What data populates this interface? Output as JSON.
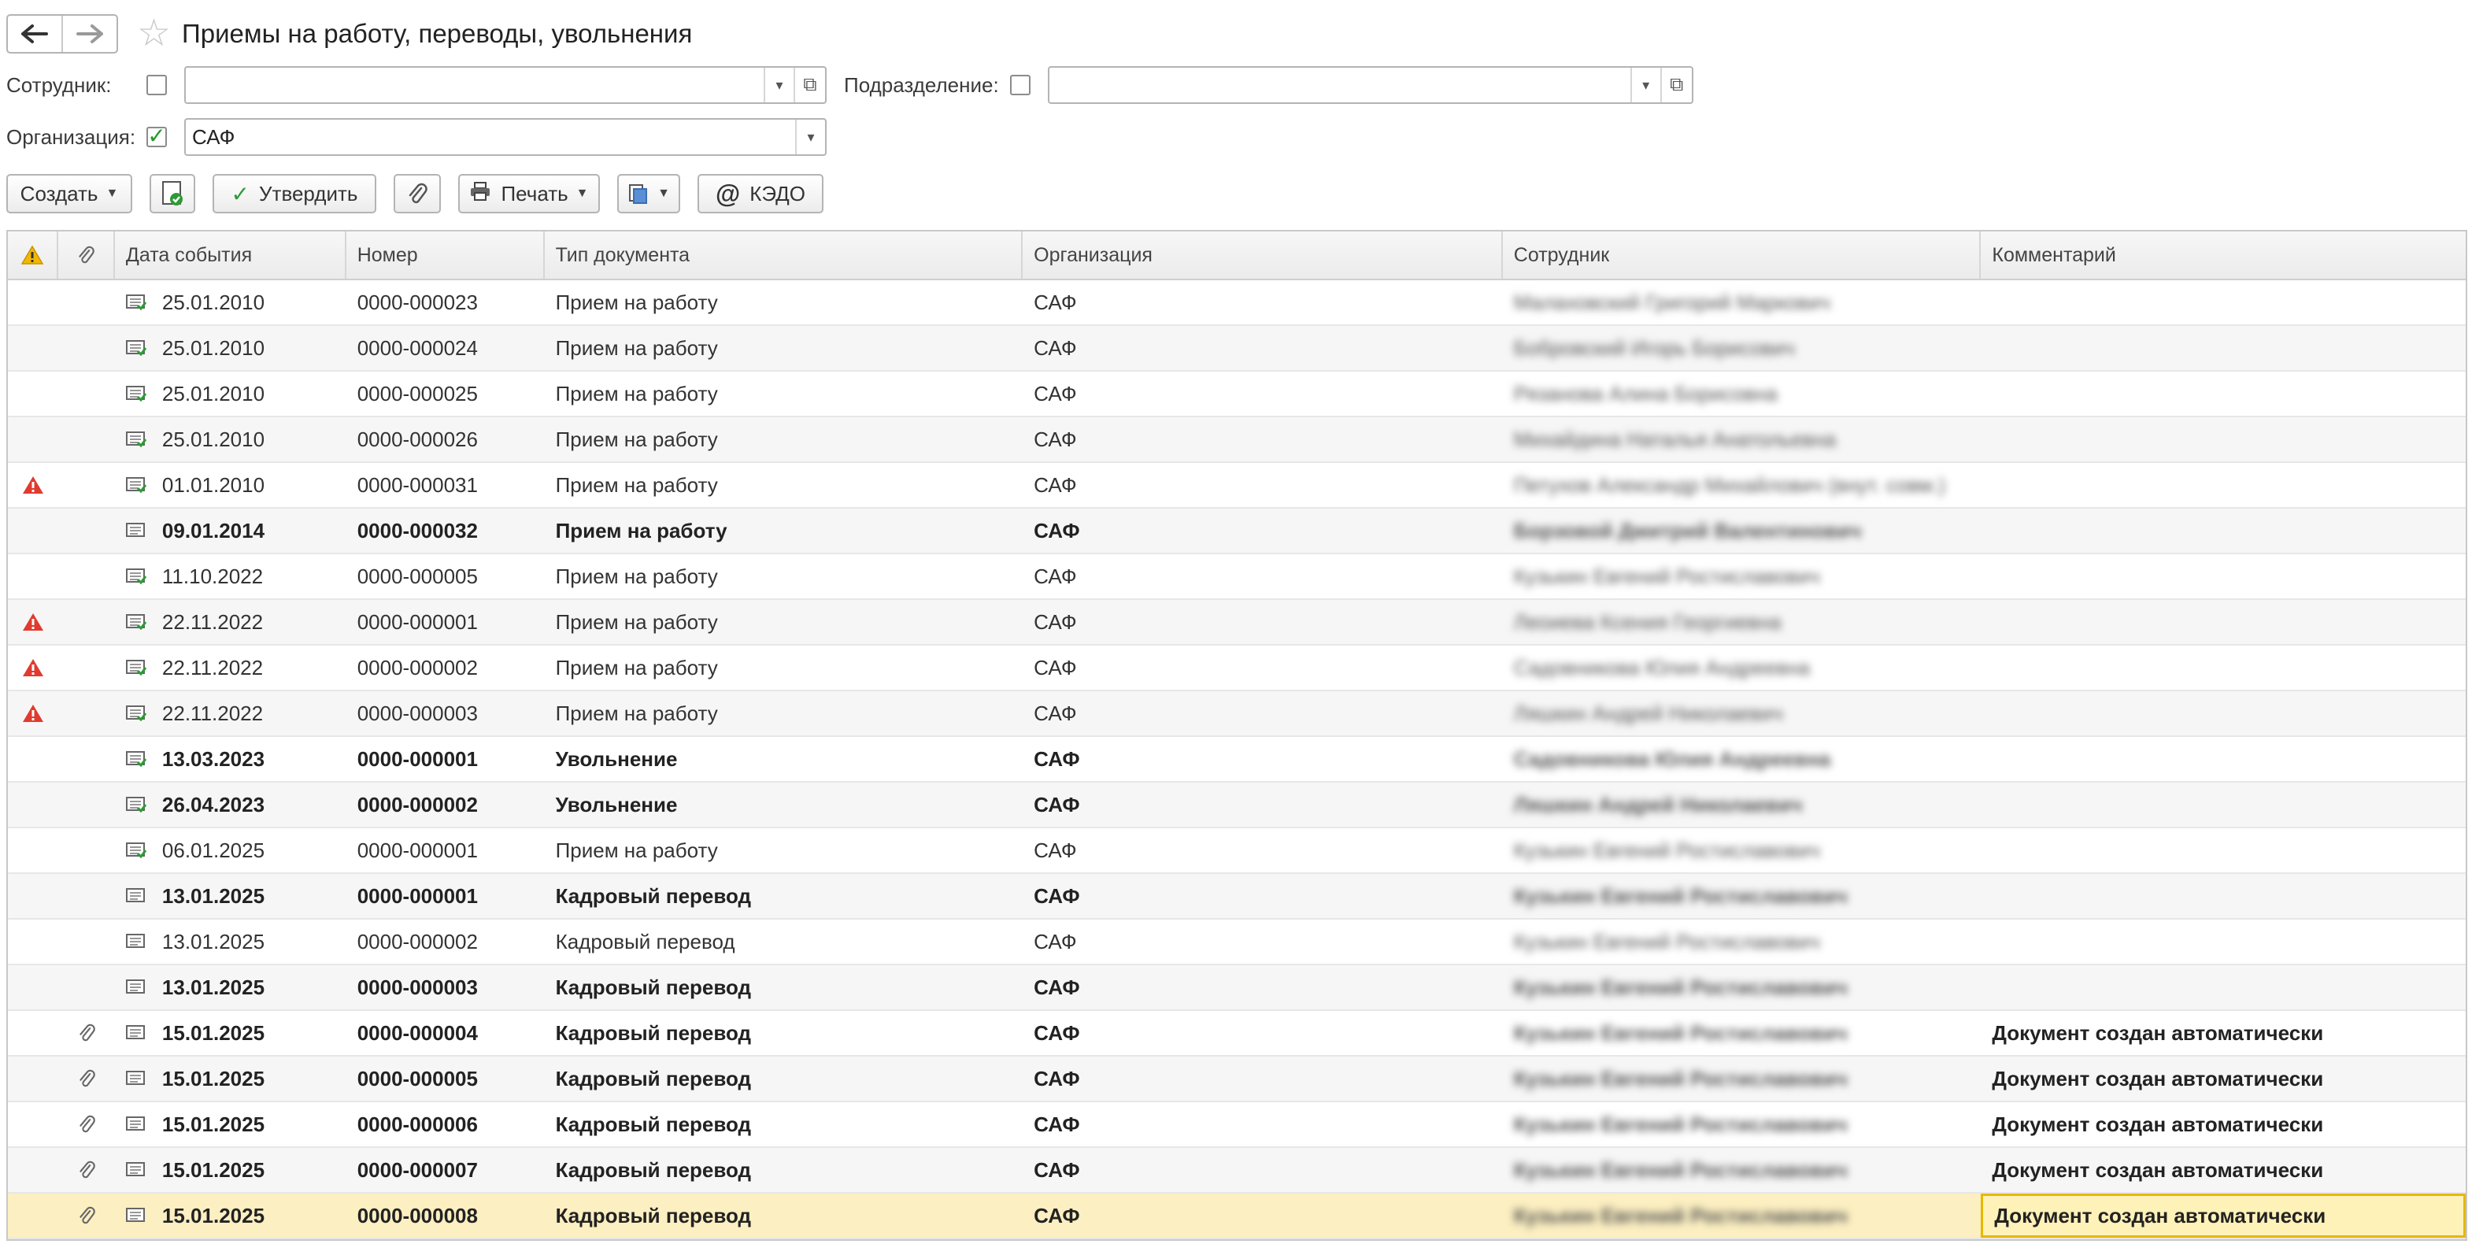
{
  "header": {
    "title": "Приемы на работу, переводы, увольнения"
  },
  "filters": {
    "employee_label": "Сотрудник:",
    "employee_value": "",
    "employee_checked": false,
    "department_label": "Подразделение:",
    "department_value": "",
    "department_checked": false,
    "org_label": "Организация:",
    "org_value": "САФ",
    "org_checked": true
  },
  "toolbar": {
    "create_label": "Создать",
    "approve_label": "Утвердить",
    "print_label": "Печать",
    "kedo_label": "КЭДО"
  },
  "table": {
    "columns": [
      "Дата события",
      "Номер",
      "Тип документа",
      "Организация",
      "Сотрудник",
      "Комментарий"
    ],
    "rows": [
      {
        "warn": false,
        "clip": false,
        "posted": true,
        "bold": false,
        "date": "25.01.2010",
        "number": "0000-000023",
        "type": "Прием на работу",
        "org": "САФ",
        "employee": "Малаховский Григорий Маркович",
        "comment": ""
      },
      {
        "warn": false,
        "clip": false,
        "posted": true,
        "bold": false,
        "date": "25.01.2010",
        "number": "0000-000024",
        "type": "Прием на работу",
        "org": "САФ",
        "employee": "Бобровский Игорь Борисович",
        "comment": ""
      },
      {
        "warn": false,
        "clip": false,
        "posted": true,
        "bold": false,
        "date": "25.01.2010",
        "number": "0000-000025",
        "type": "Прием на работу",
        "org": "САФ",
        "employee": "Рязанова Алина Борисовна",
        "comment": ""
      },
      {
        "warn": false,
        "clip": false,
        "posted": true,
        "bold": false,
        "date": "25.01.2010",
        "number": "0000-000026",
        "type": "Прием на работу",
        "org": "САФ",
        "employee": "Михайдина Наталья Анатольевна",
        "comment": ""
      },
      {
        "warn": true,
        "clip": false,
        "posted": true,
        "bold": false,
        "date": "01.01.2010",
        "number": "0000-000031",
        "type": "Прием на работу",
        "org": "САФ",
        "employee": "Петухов Александр Михайлович (внут. совм.)",
        "comment": ""
      },
      {
        "warn": false,
        "clip": false,
        "posted": false,
        "bold": true,
        "date": "09.01.2014",
        "number": "0000-000032",
        "type": "Прием на работу",
        "org": "САФ",
        "employee": "Борзовой Дмитрий Валентинович",
        "comment": ""
      },
      {
        "warn": false,
        "clip": false,
        "posted": true,
        "bold": false,
        "date": "11.10.2022",
        "number": "0000-000005",
        "type": "Прием на работу",
        "org": "САФ",
        "employee": "Кузькин Евгений Ростиславович",
        "comment": ""
      },
      {
        "warn": true,
        "clip": false,
        "posted": true,
        "bold": false,
        "date": "22.11.2022",
        "number": "0000-000001",
        "type": "Прием на работу",
        "org": "САФ",
        "employee": "Леоиева Ксения Георгиевна",
        "comment": ""
      },
      {
        "warn": true,
        "clip": false,
        "posted": true,
        "bold": false,
        "date": "22.11.2022",
        "number": "0000-000002",
        "type": "Прием на работу",
        "org": "САФ",
        "employee": "Садовникова Юлия Андреевна",
        "comment": ""
      },
      {
        "warn": true,
        "clip": false,
        "posted": true,
        "bold": false,
        "date": "22.11.2022",
        "number": "0000-000003",
        "type": "Прием на работу",
        "org": "САФ",
        "employee": "Ляшкин Андрей Николаевич",
        "comment": ""
      },
      {
        "warn": false,
        "clip": false,
        "posted": true,
        "bold": true,
        "date": "13.03.2023",
        "number": "0000-000001",
        "type": "Увольнение",
        "org": "САФ",
        "employee": "Садовникова Юлия Андреевна",
        "comment": ""
      },
      {
        "warn": false,
        "clip": false,
        "posted": true,
        "bold": true,
        "date": "26.04.2023",
        "number": "0000-000002",
        "type": "Увольнение",
        "org": "САФ",
        "employee": "Ляшкин Андрей Николаевич",
        "comment": ""
      },
      {
        "warn": false,
        "clip": false,
        "posted": true,
        "bold": false,
        "date": "06.01.2025",
        "number": "0000-000001",
        "type": "Прием на работу",
        "org": "САФ",
        "employee": "Кузькин Евгений Ростиславович",
        "comment": ""
      },
      {
        "warn": false,
        "clip": false,
        "posted": false,
        "bold": true,
        "date": "13.01.2025",
        "number": "0000-000001",
        "type": "Кадровый перевод",
        "org": "САФ",
        "employee": "Кузькин Евгений Ростиславович",
        "comment": ""
      },
      {
        "warn": false,
        "clip": false,
        "posted": false,
        "bold": false,
        "date": "13.01.2025",
        "number": "0000-000002",
        "type": "Кадровый перевод",
        "org": "САФ",
        "employee": "Кузькин Евгений Ростиславович",
        "comment": ""
      },
      {
        "warn": false,
        "clip": false,
        "posted": false,
        "bold": true,
        "date": "13.01.2025",
        "number": "0000-000003",
        "type": "Кадровый перевод",
        "org": "САФ",
        "employee": "Кузькин Евгений Ростиславович",
        "comment": ""
      },
      {
        "warn": false,
        "clip": true,
        "posted": false,
        "bold": true,
        "date": "15.01.2025",
        "number": "0000-000004",
        "type": "Кадровый перевод",
        "org": "САФ",
        "employee": "Кузькин Евгений Ростиславович",
        "comment": "Документ создан автоматически"
      },
      {
        "warn": false,
        "clip": true,
        "posted": false,
        "bold": true,
        "date": "15.01.2025",
        "number": "0000-000005",
        "type": "Кадровый перевод",
        "org": "САФ",
        "employee": "Кузькин Евгений Ростиславович",
        "comment": "Документ создан автоматически"
      },
      {
        "warn": false,
        "clip": true,
        "posted": false,
        "bold": true,
        "date": "15.01.2025",
        "number": "0000-000006",
        "type": "Кадровый перевод",
        "org": "САФ",
        "employee": "Кузькин Евгений Ростиславович",
        "comment": "Документ создан автоматически"
      },
      {
        "warn": false,
        "clip": true,
        "posted": false,
        "bold": true,
        "date": "15.01.2025",
        "number": "0000-000007",
        "type": "Кадровый перевод",
        "org": "САФ",
        "employee": "Кузькин Евгений Ростиславович",
        "comment": "Документ создан автоматически"
      },
      {
        "warn": false,
        "clip": true,
        "posted": false,
        "bold": true,
        "selected": true,
        "date": "15.01.2025",
        "number": "0000-000008",
        "type": "Кадровый перевод",
        "org": "САФ",
        "employee": "Кузькин Евгений Ростиславович",
        "comment": "Документ создан автоматически"
      }
    ]
  },
  "colors": {
    "warning": "#e03b30",
    "posted": "#2e9a36",
    "selection": "#fcefc1"
  }
}
